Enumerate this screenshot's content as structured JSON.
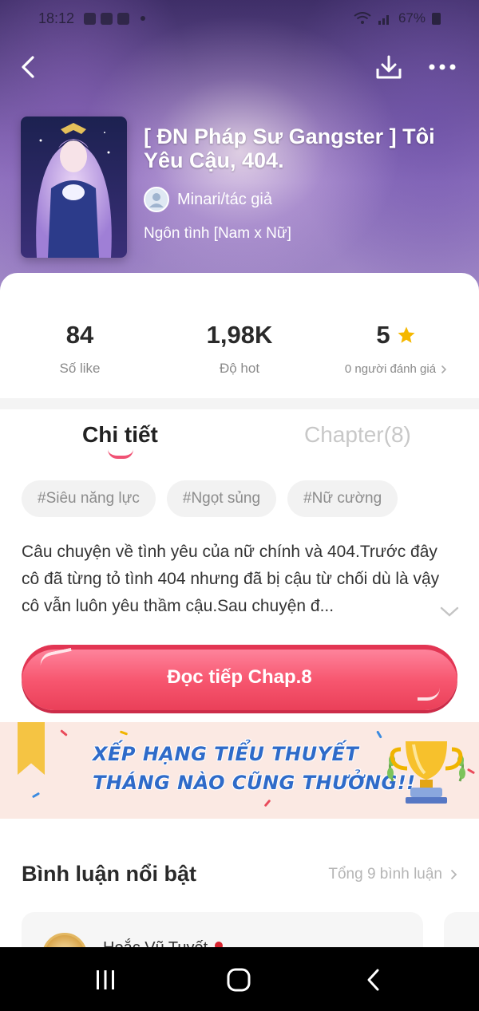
{
  "status_bar": {
    "time": "18:12",
    "battery": "67%"
  },
  "header": {
    "back_icon": "chevron-left-icon",
    "download_icon": "download-icon",
    "more_icon": "more-dots-icon"
  },
  "story": {
    "title": "[ ĐN Pháp Sư Gangster ] Tôi Yêu Cậu, 404.",
    "author": "Minari/tác giả",
    "genre": "Ngôn tình [Nam x Nữ]"
  },
  "stats": {
    "likes_value": "84",
    "likes_label": "Số like",
    "hot_value": "1,98K",
    "hot_label": "Độ hot",
    "rating_value": "5",
    "rating_label": "0 người đánh giá"
  },
  "tabs": {
    "detail": "Chi tiết",
    "chapter": "Chapter(8)"
  },
  "tags": [
    "#Siêu năng lực",
    "#Ngọt sủng",
    "#Nữ cường"
  ],
  "synopsis": "Câu chuyện về tình yêu của nữ chính và 404.Trước đây cô đã từng tỏ tình 404 nhưng đã bị cậu từ chối dù là vậy cô vẫn luôn yêu thầm cậu.Sau chuyện đ...",
  "read_button": "Đọc tiếp Chap.8",
  "banner": {
    "line1": "XẾP HẠNG TIỂU THUYẾT",
    "line2": "THÁNG NÀO CŨNG THƯỞNG!!"
  },
  "comments": {
    "title": "Bình luận nổi bật",
    "total": "Tổng 9 bình luận",
    "first_user": "Hoắc Vũ Tuyết"
  },
  "colors": {
    "accent": "#f05274",
    "star": "#f5b800",
    "banner_text": "#2f6bc9"
  }
}
